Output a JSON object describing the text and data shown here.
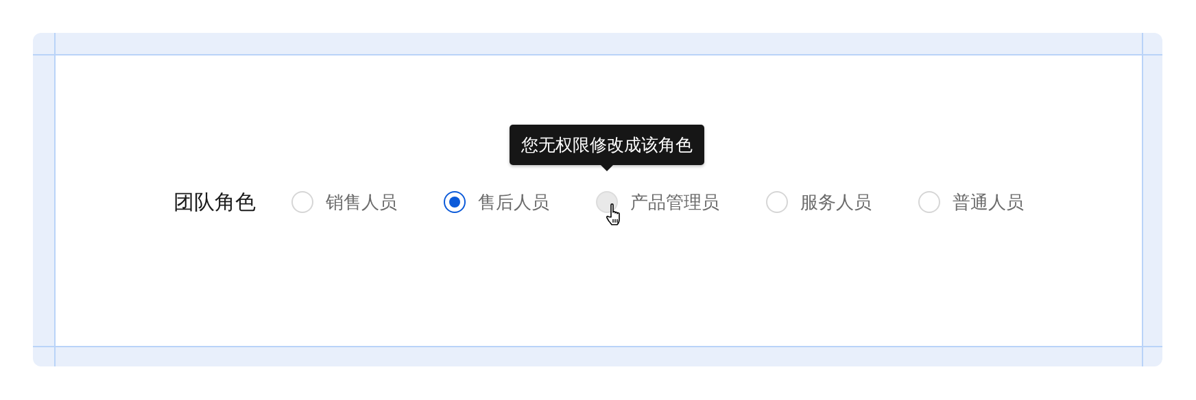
{
  "field": {
    "label": "团队角色",
    "options": [
      {
        "label": "销售人员",
        "selected": false,
        "disabled": false
      },
      {
        "label": "售后人员",
        "selected": true,
        "disabled": false
      },
      {
        "label": "产品管理员",
        "selected": false,
        "disabled": true,
        "hovered": true,
        "tooltip": "您无权限修改成该角色"
      },
      {
        "label": "服务人员",
        "selected": false,
        "disabled": false
      },
      {
        "label": "普通人员",
        "selected": false,
        "disabled": false
      }
    ]
  }
}
